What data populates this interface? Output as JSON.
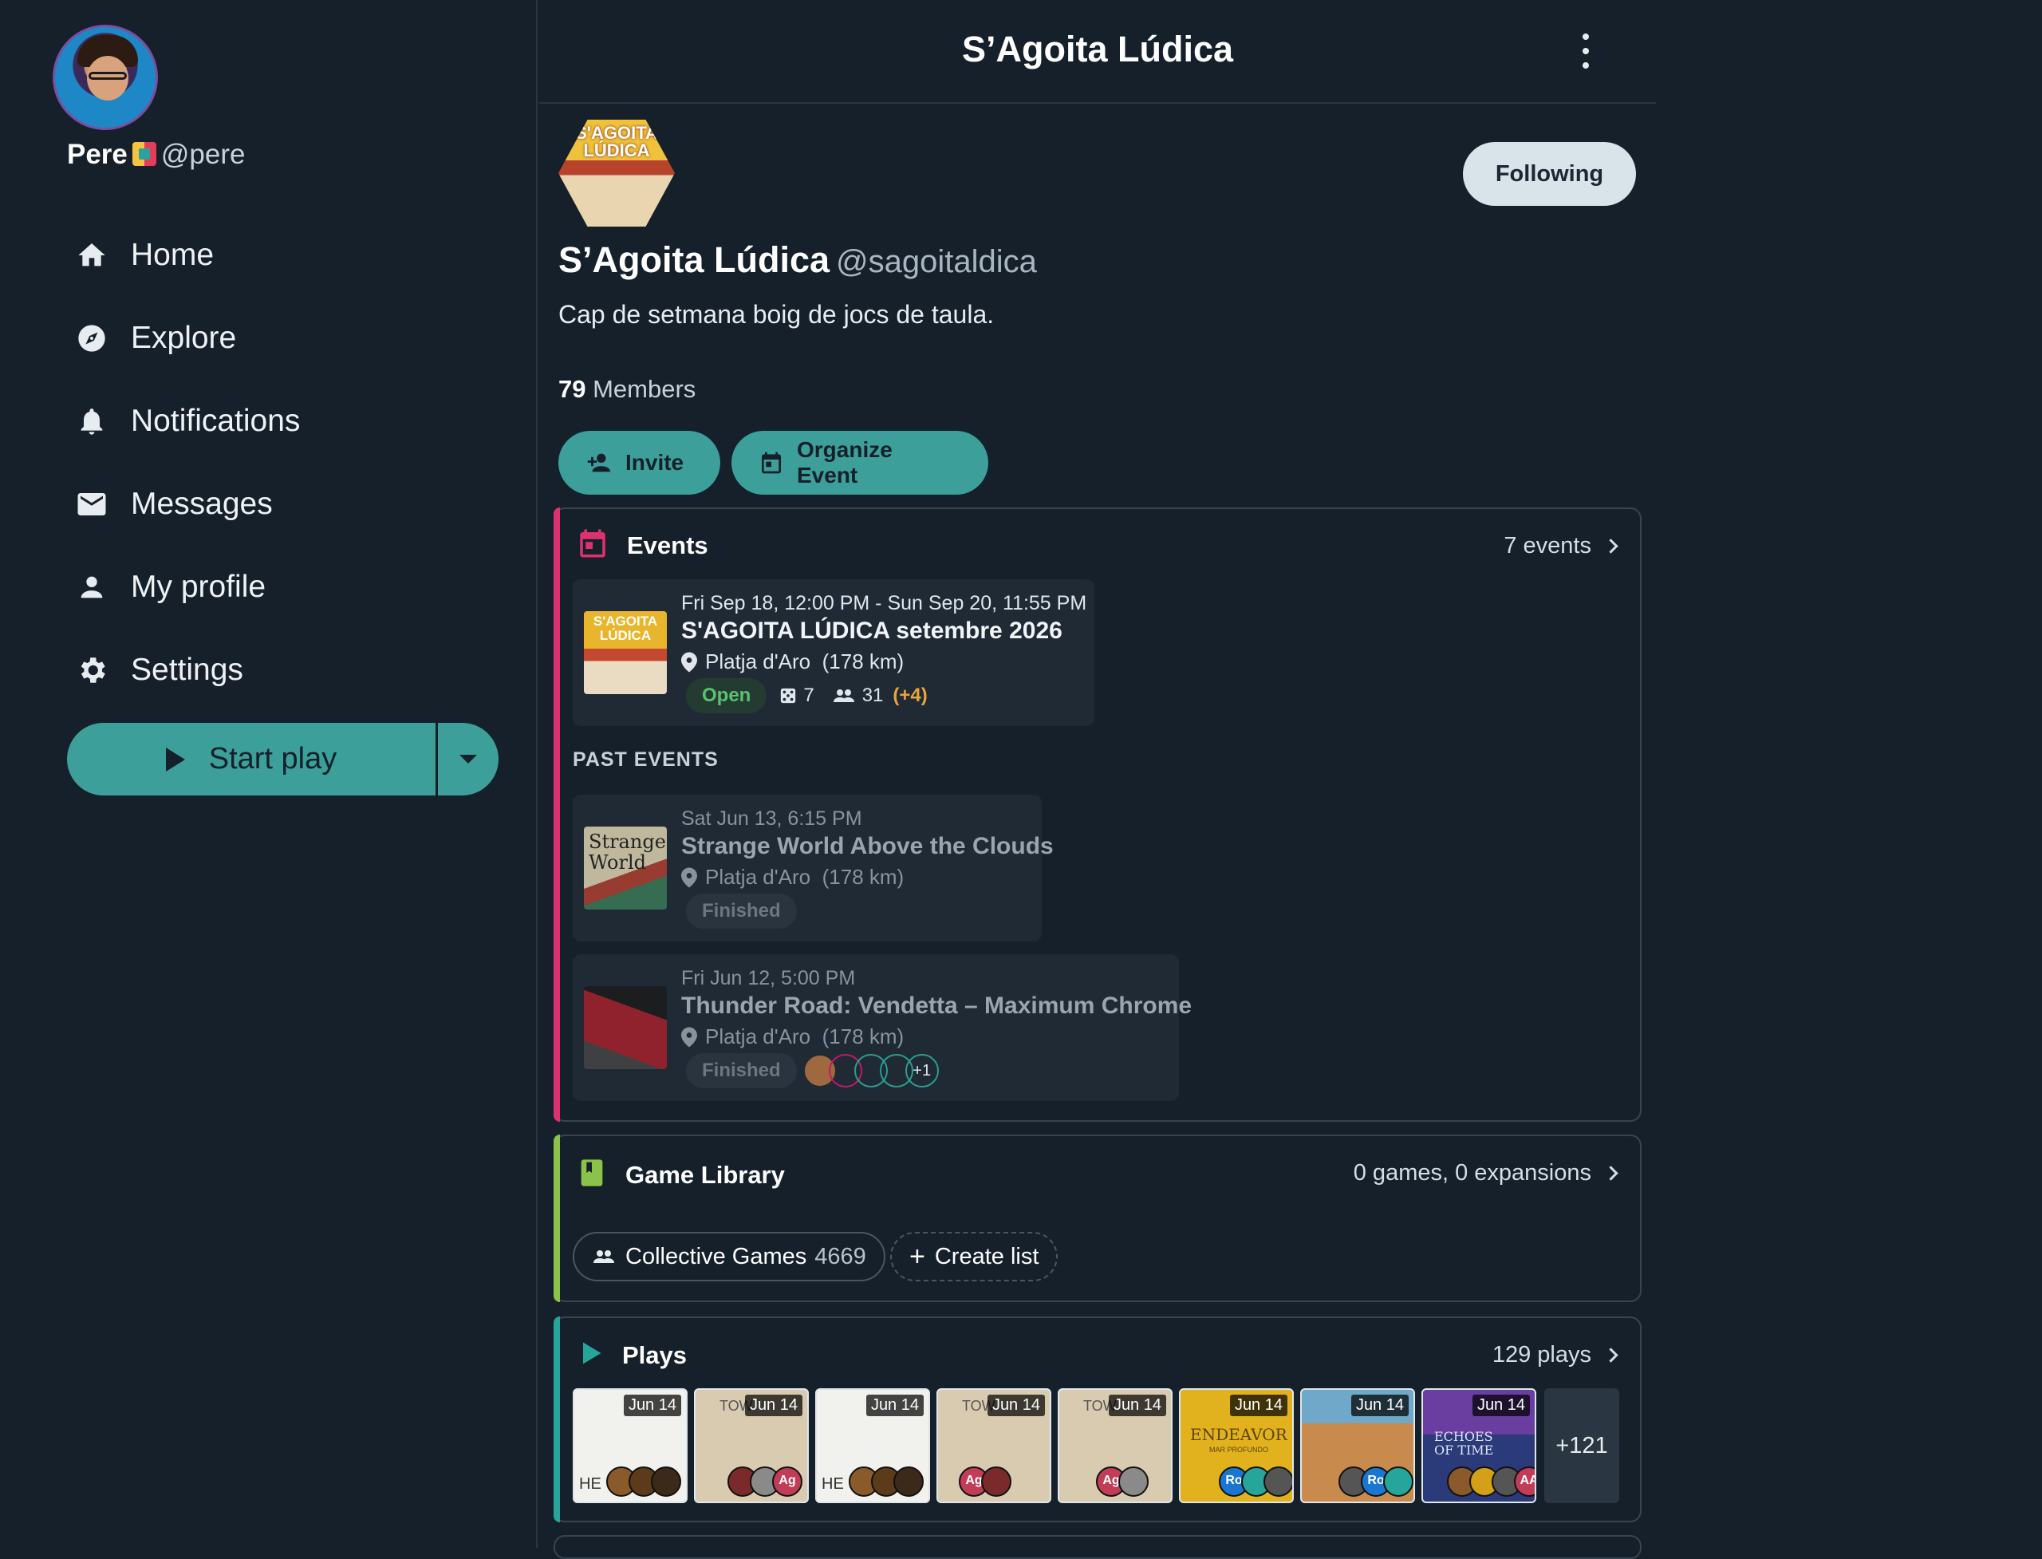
{
  "user": {
    "name": "Pere",
    "handle": "@pere"
  },
  "nav": {
    "items": [
      {
        "label": "Home",
        "icon": "home-icon"
      },
      {
        "label": "Explore",
        "icon": "compass-icon"
      },
      {
        "label": "Notifications",
        "icon": "bell-icon"
      },
      {
        "label": "Messages",
        "icon": "mail-icon"
      },
      {
        "label": "My profile",
        "icon": "person-icon"
      },
      {
        "label": "Settings",
        "icon": "gear-icon"
      }
    ],
    "start_play": "Start play"
  },
  "header": {
    "title": "S’Agoita Lúdica"
  },
  "group": {
    "logo_text": "S'AGOITA LÚDICA",
    "name": "S’Agoita Lúdica",
    "handle": "@sagoitaldica",
    "description": "Cap de setmana boig de jocs de taula.",
    "members_count": "79",
    "members_label": "Members",
    "follow_label": "Following",
    "invite_label": "Invite",
    "organize_label": "Organize Event"
  },
  "events": {
    "title": "Events",
    "count_label": "7 events",
    "past_label": "PAST EVENTS",
    "upcoming": {
      "date": "Fri Sep 18, 12:00 PM - Sun Sep 20, 11:55 PM",
      "title": "S'AGOITA LÚDICA setembre 2026",
      "location": "Platja d'Aro",
      "distance": "(178 km)",
      "status": "Open",
      "games": "7",
      "attendees": "31",
      "extra": "(+4)",
      "thumb_text": "S'AGOITA LÚDICA"
    },
    "past": [
      {
        "date": "Sat Jun 13, 6:15 PM",
        "title": "Strange World Above the Clouds",
        "location": "Platja d'Aro",
        "distance": "(178 km)",
        "status": "Finished",
        "thumb_text": "Strange World"
      },
      {
        "date": "Fri Jun 12, 5:00 PM",
        "title": "Thunder Road: Vendetta – Maximum Chrome",
        "location": "Platja d'Aro",
        "distance": "(178 km)",
        "status": "Finished",
        "more": "+1"
      }
    ]
  },
  "library": {
    "title": "Game Library",
    "count_label": "0 games, 0 expansions",
    "collective_label": "Collective Games",
    "collective_count": "4669",
    "create_label": "Create list"
  },
  "plays": {
    "title": "Plays",
    "count_label": "129 plays",
    "more": "+121",
    "items": [
      {
        "date": "Jun 14",
        "bg": "#f1f1ee",
        "label": "HE"
      },
      {
        "date": "Jun 14",
        "bg": "#d9cbb0",
        "label": "TOW",
        "initials": "Ag"
      },
      {
        "date": "Jun 14",
        "bg": "#f1f1ee",
        "label": "HE"
      },
      {
        "date": "Jun 14",
        "bg": "#d9cbb0",
        "label": "TOW",
        "initials": "Ag"
      },
      {
        "date": "Jun 14",
        "bg": "#d9cbb0",
        "label": "TOW",
        "initials": "Ag"
      },
      {
        "date": "Jun 14",
        "bg": "#e2b21e",
        "label": "ENDEAVOR",
        "sublabel": "MAR PROFUNDO",
        "initials": "Ro"
      },
      {
        "date": "Jun 14",
        "bg": "#c98a4e",
        "label": "",
        "initials": "Ro"
      },
      {
        "date": "Jun 14",
        "bg": "#2b3a78",
        "label": "ECHOES OF TIME",
        "initials": "AA"
      }
    ]
  },
  "colors": {
    "accent": "#3d9f9a",
    "events_bar": "#e0316f",
    "library_bar": "#8bc34a",
    "plays_bar": "#26a69a",
    "background": "#15202b"
  }
}
